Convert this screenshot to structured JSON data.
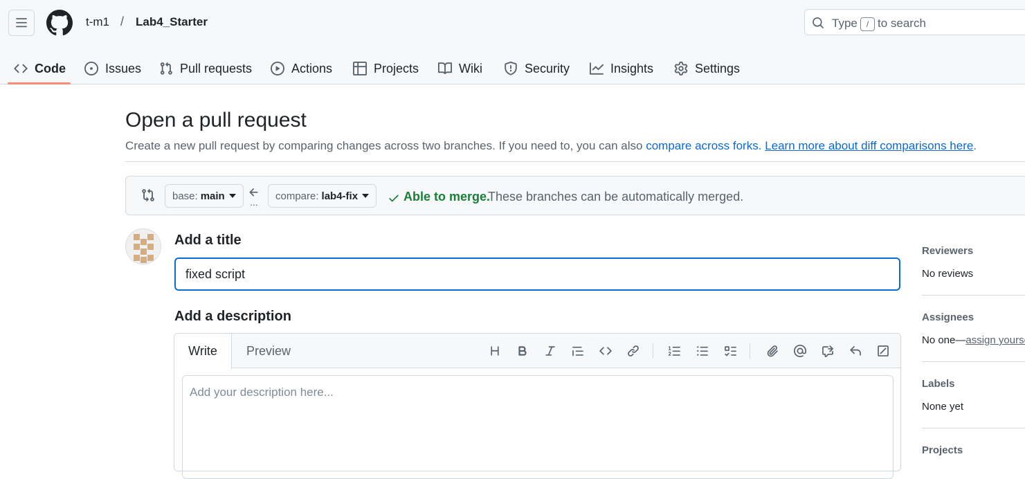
{
  "header": {
    "owner": "t-m1",
    "separator": "/",
    "repo": "Lab4_Starter",
    "search": {
      "prefix": "Type",
      "key": "/",
      "suffix": "to search"
    }
  },
  "nav": {
    "tabs": [
      {
        "label": "Code",
        "icon": "code-icon",
        "active": true
      },
      {
        "label": "Issues",
        "icon": "issue-opened-icon"
      },
      {
        "label": "Pull requests",
        "icon": "git-pull-request-icon"
      },
      {
        "label": "Actions",
        "icon": "play-icon"
      },
      {
        "label": "Projects",
        "icon": "table-icon"
      },
      {
        "label": "Wiki",
        "icon": "book-icon"
      },
      {
        "label": "Security",
        "icon": "shield-icon"
      },
      {
        "label": "Insights",
        "icon": "graph-icon"
      },
      {
        "label": "Settings",
        "icon": "gear-icon"
      }
    ],
    "active_color": "#fd8c73"
  },
  "page": {
    "title": "Open a pull request",
    "subtitle_text": "Create a new pull request by comparing changes across two branches. If you need to, you can also ",
    "compare_forks_link": "compare across forks.",
    "learn_more_link": "Learn more about diff comparisons here",
    "subtitle_end": "."
  },
  "compare": {
    "base_prefix": "base:",
    "base_branch": "main",
    "compare_prefix": "compare:",
    "compare_branch": "lab4-fix",
    "ellipsis": "...",
    "merge_status": "Able to merge.",
    "merge_message": "These branches can be automatically merged.",
    "merge_color": "#1a7f37"
  },
  "form": {
    "title_label": "Add a title",
    "title_value": "fixed script",
    "description_label": "Add a description",
    "write_tab": "Write",
    "preview_tab": "Preview",
    "description_placeholder": "Add your description here...",
    "toolbar": [
      "heading-icon",
      "bold-icon",
      "italic-icon",
      "quote-icon",
      "code-icon",
      "link-icon",
      "ordered-list-icon",
      "unordered-list-icon",
      "tasklist-icon",
      "paperclip-icon",
      "mention-icon",
      "cross-reference-icon",
      "reply-icon",
      "slash-command-icon"
    ]
  },
  "sidebar": {
    "reviewers_label": "Reviewers",
    "reviewers_value": "No reviews",
    "assignees_label": "Assignees",
    "assignees_value": "No one—",
    "assignees_link": "assign yourself",
    "labels_label": "Labels",
    "labels_value": "None yet",
    "projects_label": "Projects"
  },
  "colors": {
    "link": "#0969da",
    "focus": "#0969da",
    "muted": "#59636e"
  }
}
